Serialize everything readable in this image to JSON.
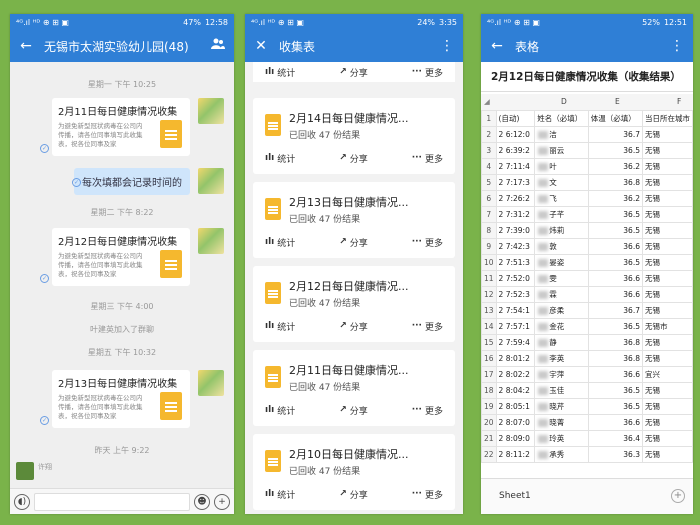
{
  "phone1": {
    "status": {
      "left": "⁴ᴳ.ıl ᴴᴰ ⊕ ⊞ ▣",
      "battery": "47%",
      "time": "12:58"
    },
    "title": "无锡市太湖实验幼儿园(48)",
    "back": "←",
    "timestamps": [
      "星期一 下午 10:25",
      "星期二 下午 8:22",
      "星期三 下午 4:00",
      "星期五 下午 10:32",
      "昨天 上午 9:22"
    ],
    "cards": [
      {
        "title": "2月11日每日健康情况收集",
        "body": "为避免新型冠状病毒在公司内传播，请各位同事填写此收集表，祝各位同事及家"
      },
      {
        "title": "2月12日每日健康情况收集",
        "body": "为避免新型冠状病毒在公司内传播，请各位同事填写此收集表，祝各位同事及家"
      },
      {
        "title": "2月13日每日健康情况收集",
        "body": "为避免新型冠状病毒在公司内传播，请各位同事填写此收集表，祝各位同事及家"
      }
    ],
    "bubble": "每次填都会记录时间的",
    "system_msg": "叶建英加入了群聊",
    "last_sender": "许翔"
  },
  "phone2": {
    "status": {
      "left": "⁴ᴳ.ıl ᴴᴰ ⊕ ⊞ ▣",
      "battery": "24%",
      "time": "3:35"
    },
    "title": "收集表",
    "close": "✕",
    "menu": "⋮",
    "actions": {
      "stats": "统计",
      "share": "分享",
      "more": "更多"
    },
    "forms": [
      {
        "title": "2月14日每日健康情况...",
        "sub": "已回收 47 份结果"
      },
      {
        "title": "2月13日每日健康情况...",
        "sub": "已回收 47 份结果"
      },
      {
        "title": "2月12日每日健康情况...",
        "sub": "已回收 47 份结果"
      },
      {
        "title": "2月11日每日健康情况...",
        "sub": "已回收 47 份结果"
      },
      {
        "title": "2月10日每日健康情况...",
        "sub": "已回收 47 份结果"
      }
    ]
  },
  "phone3": {
    "status": {
      "left": "⁴ᴳ.ıl ᴴᴰ ⊕ ⊞ ▣",
      "battery": "52%",
      "time": "12:51"
    },
    "title": "表格",
    "menu": "⋮",
    "sheet_title": "2月12日每日健康情况收集（收集结果）",
    "col_letters": [
      "D",
      "E",
      "F"
    ],
    "headers": [
      "(自动)",
      "姓名（必填）",
      "体温（必填）",
      "当日所在城市"
    ],
    "rows": [
      [
        "2",
        "2 6:12:0",
        "洁",
        "36.7",
        "无锡"
      ],
      [
        "3",
        "2 6:39:2",
        "丽云",
        "36.5",
        "无锡"
      ],
      [
        "4",
        "2 7:11:4",
        "叶",
        "36.2",
        "无锡"
      ],
      [
        "5",
        "2 7:17:3",
        "文",
        "36.8",
        "无锡"
      ],
      [
        "6",
        "2 7:26:2",
        "飞",
        "36.2",
        "无锡"
      ],
      [
        "7",
        "2 7:31:2",
        "子芊",
        "36.5",
        "无锡"
      ],
      [
        "8",
        "2 7:39:0",
        "炜莉",
        "36.5",
        "无锡"
      ],
      [
        "9",
        "2 7:42:3",
        "敦",
        "36.6",
        "无锡"
      ],
      [
        "10",
        "2 7:51:3",
        "晏姿",
        "36.5",
        "无锡"
      ],
      [
        "11",
        "2 7:52:0",
        "雯",
        "36.6",
        "无锡"
      ],
      [
        "12",
        "2 7:52:3",
        "霖",
        "36.6",
        "无锡"
      ],
      [
        "13",
        "2 7:54:1",
        "彦柔",
        "36.7",
        "无锡"
      ],
      [
        "14",
        "2 7:57:1",
        "金花",
        "36.5",
        "无锡市"
      ],
      [
        "15",
        "2 7:59:4",
        "静",
        "36.8",
        "无锡"
      ],
      [
        "16",
        "2 8:01:2",
        "李英",
        "36.8",
        "无锡"
      ],
      [
        "17",
        "2 8:02:2",
        "宇萍",
        "36.6",
        "宜兴"
      ],
      [
        "18",
        "2 8:04:2",
        "玉佳",
        "36.5",
        "无锡"
      ],
      [
        "19",
        "2 8:05:1",
        "晓芹",
        "36.5",
        "无锡"
      ],
      [
        "20",
        "2 8:07:0",
        "晓菁",
        "36.6",
        "无锡"
      ],
      [
        "21",
        "2 8:09:0",
        "玲英",
        "36.4",
        "无锡"
      ],
      [
        "22",
        "2 8:11:2",
        "承秀",
        "36.3",
        "无锡"
      ]
    ],
    "row_header_1": "1",
    "sheet_tab": "Sheet1"
  }
}
